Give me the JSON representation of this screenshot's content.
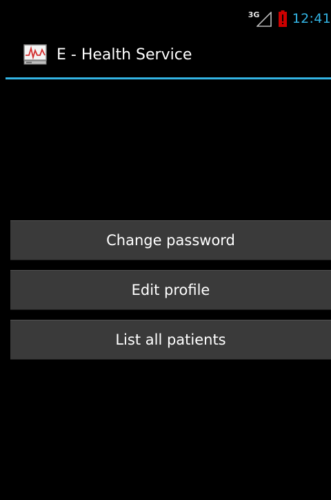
{
  "status_bar": {
    "network_type": "3G",
    "clock": "12:41",
    "signal_icon": "signal-strength-icon",
    "battery_icon": "battery-low-icon"
  },
  "action_bar": {
    "app_icon": "heart-monitor-icon",
    "title": "E - Health Service",
    "accent_color": "#33b5e5"
  },
  "menu": {
    "buttons": [
      {
        "label": "Change password"
      },
      {
        "label": "Edit profile"
      },
      {
        "label": "List all patients"
      }
    ]
  }
}
